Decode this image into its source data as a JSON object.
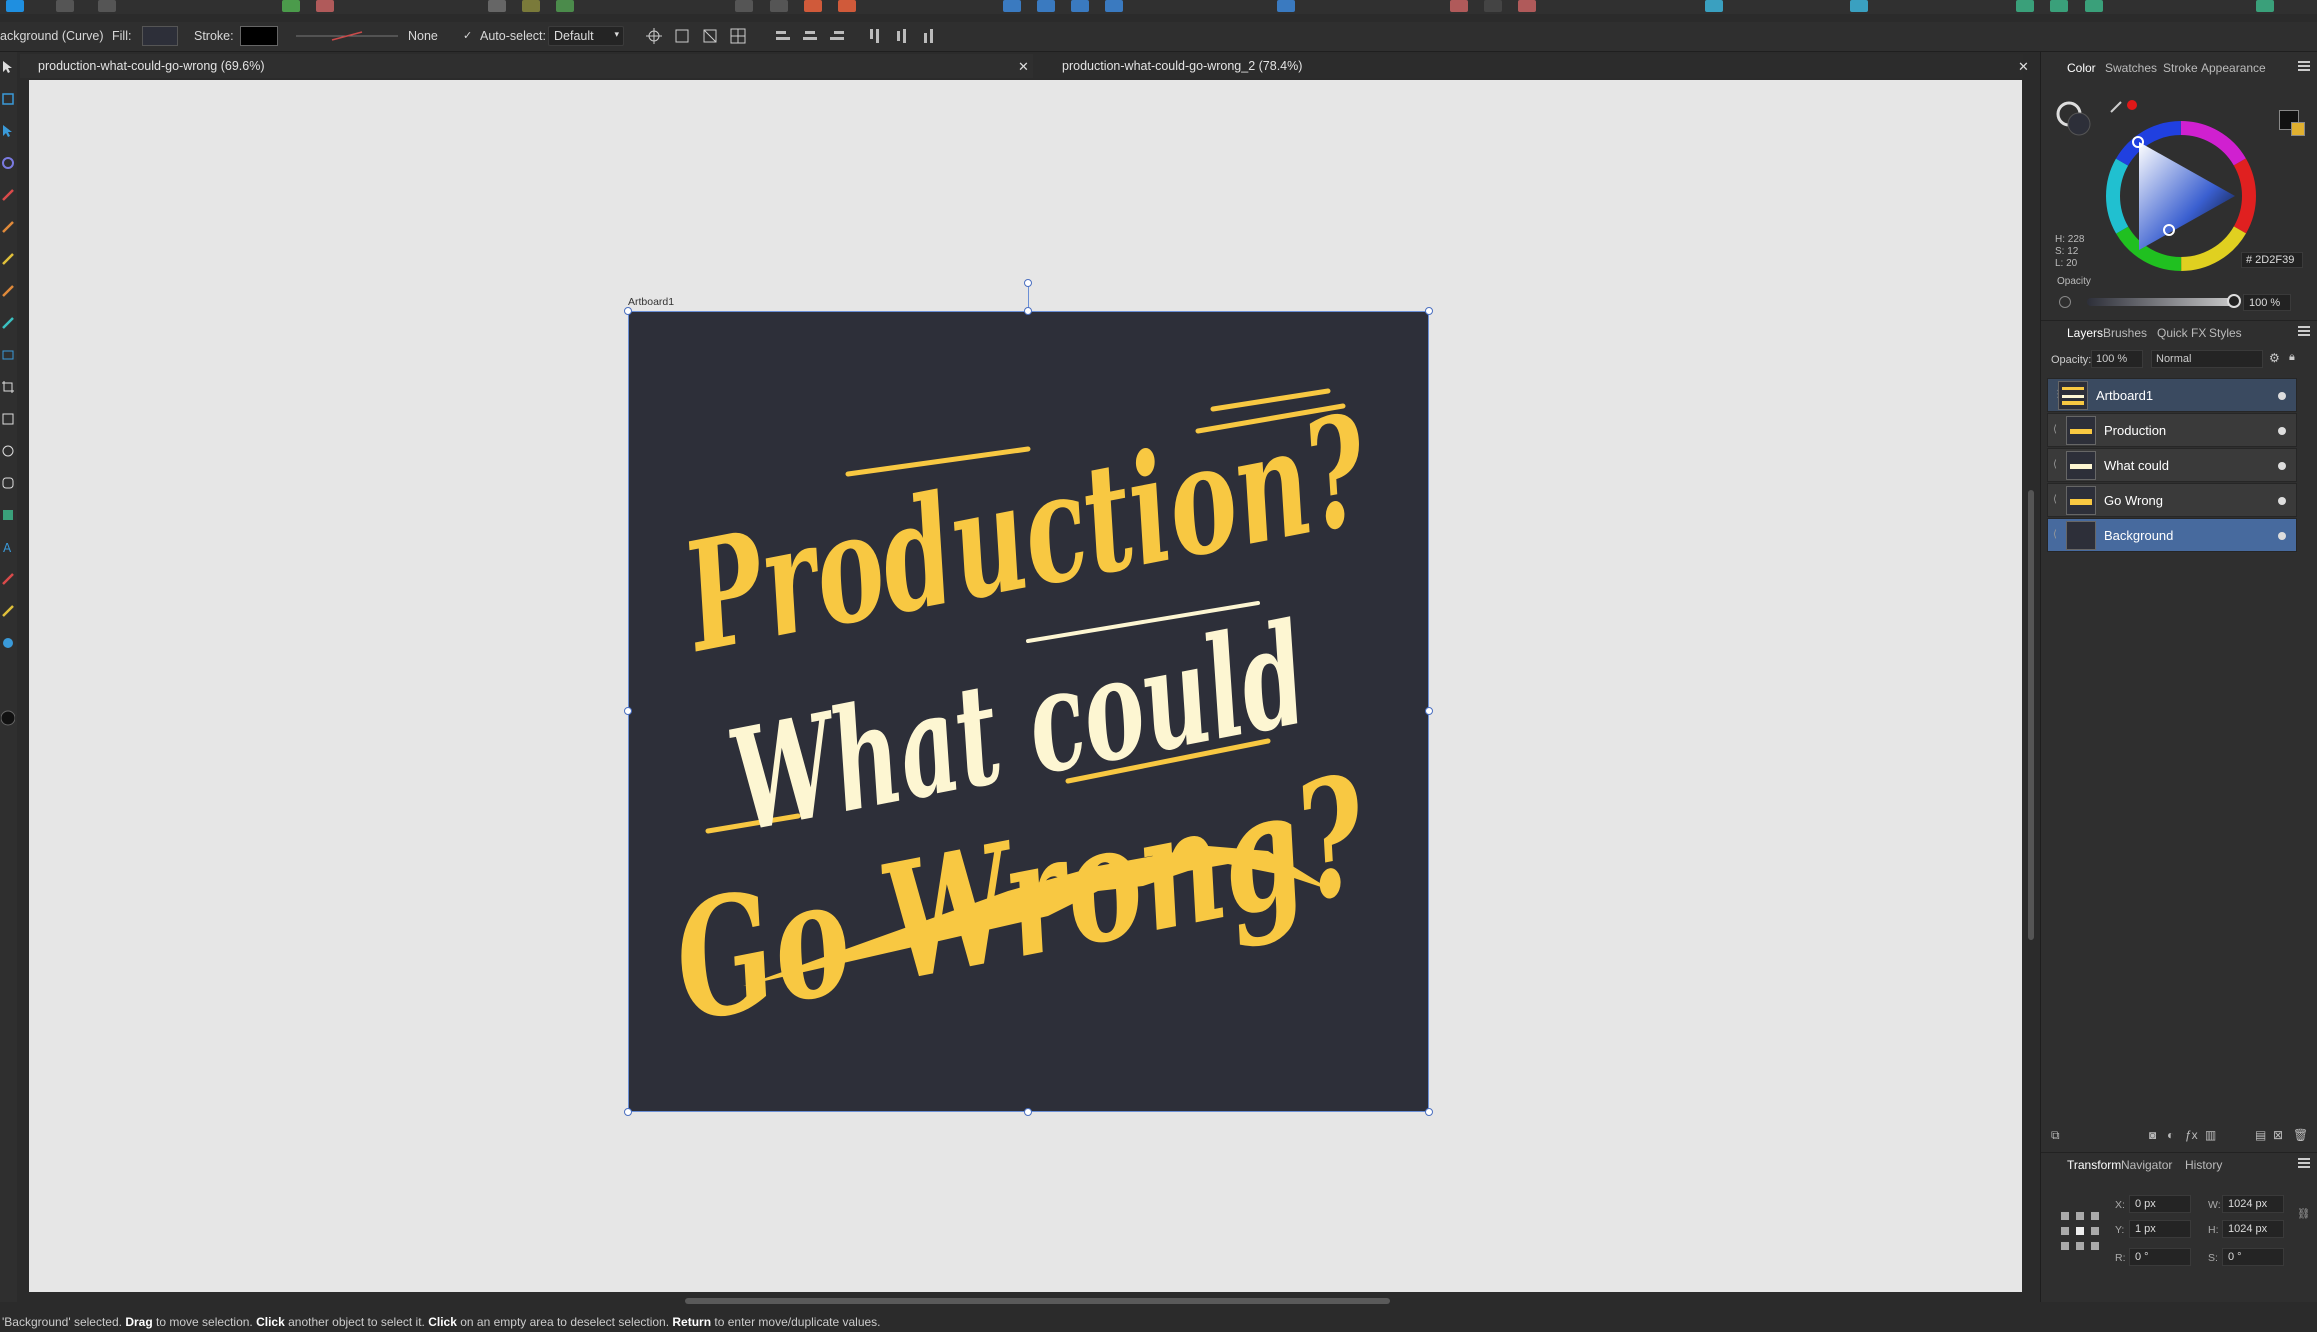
{
  "context_toolbar": {
    "selection_label": "ackground (Curve)",
    "fill_label": "Fill:",
    "stroke_label": "Stroke:",
    "stroke_style": "None",
    "auto_select_label": "Auto-select:",
    "auto_select_value": "Default",
    "fill_color": "#2d2f39",
    "stroke_color": "#000000"
  },
  "document_tabs": [
    {
      "label": "production-what-could-go-wrong (69.6%)",
      "active": true
    },
    {
      "label": "production-what-could-go-wrong_2 (78.4%)",
      "active": false
    }
  ],
  "canvas": {
    "artboard_label": "Artboard1",
    "artboard_color": "#2d2f39",
    "artwork_lines": [
      "Production?",
      "What could",
      "Go Wrong?"
    ],
    "artwork_colors": {
      "yellow": "#f8c842",
      "cream": "#fdf6d2"
    }
  },
  "color_panel": {
    "tabs": [
      "Color",
      "Swatches",
      "Stroke",
      "Appearance"
    ],
    "hsl": {
      "h": "H: 228",
      "s": "S: 12",
      "l": "L: 20"
    },
    "hex": "# 2D2F39",
    "opacity_label": "Opacity",
    "opacity_value": "100 %"
  },
  "layers_panel": {
    "tabs": [
      "Layers",
      "Brushes",
      "Quick FX",
      "Styles"
    ],
    "opacity_label": "Opacity:",
    "opacity_value": "100 %",
    "blend_mode": "Normal",
    "layers": [
      {
        "name": "Artboard1",
        "state": "artboard"
      },
      {
        "name": "Production",
        "state": "normal"
      },
      {
        "name": "What could",
        "state": "normal"
      },
      {
        "name": "Go Wrong",
        "state": "normal"
      },
      {
        "name": "Background",
        "state": "selected"
      }
    ]
  },
  "transform_panel": {
    "tabs": [
      "Transform",
      "Navigator",
      "History"
    ],
    "x_label": "X:",
    "x_value": "0 px",
    "y_label": "Y:",
    "y_value": "1 px",
    "w_label": "W:",
    "w_value": "1024 px",
    "h_label": "H:",
    "h_value": "1024 px",
    "r_label": "R:",
    "r_value": "0 °",
    "s_label": "S:",
    "s_value": "0 °"
  },
  "status_bar": {
    "selected": "'Background' selected.",
    "drag": "Drag",
    "drag_text": "to move selection.",
    "click1": "Click",
    "click1_text": "another object to select it.",
    "click2": "Click",
    "click2_text": "on an empty area to deselect selection.",
    "return": "Return",
    "return_text": "to enter move/duplicate values."
  }
}
